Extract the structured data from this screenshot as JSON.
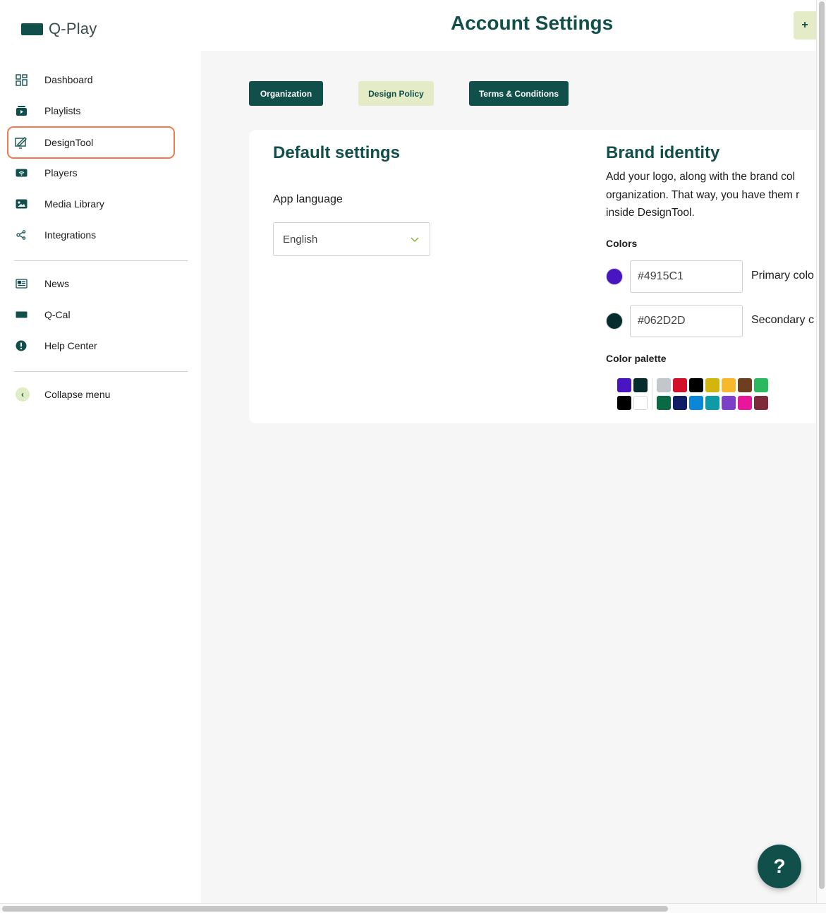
{
  "app": {
    "name": "Q-Play"
  },
  "sidebar": {
    "items": [
      {
        "label": "Dashboard",
        "icon": "dashboard-icon"
      },
      {
        "label": "Playlists",
        "icon": "playlists-icon"
      },
      {
        "label": "DesignTool",
        "icon": "designtool-icon",
        "active": true
      },
      {
        "label": "Players",
        "icon": "players-icon"
      },
      {
        "label": "Media Library",
        "icon": "media-library-icon"
      },
      {
        "label": "Integrations",
        "icon": "integrations-icon"
      }
    ],
    "secondary": [
      {
        "label": "News",
        "icon": "news-icon"
      },
      {
        "label": "Q-Cal",
        "icon": "q-cal-icon"
      },
      {
        "label": "Help Center",
        "icon": "help-center-icon"
      }
    ],
    "collapse_label": "Collapse menu"
  },
  "header": {
    "title": "Account Settings",
    "plus_label": "+"
  },
  "tabs": [
    {
      "label": "Organization",
      "style": "dark"
    },
    {
      "label": "Design Policy",
      "style": "light"
    },
    {
      "label": "Terms & Conditions",
      "style": "dark"
    }
  ],
  "default_settings": {
    "title": "Default settings",
    "language_label": "App language",
    "language_value": "English"
  },
  "brand_identity": {
    "title": "Brand identity",
    "description_lines": [
      "Add your logo, along with the brand col",
      "organization. That way, you have them r",
      "inside DesignTool."
    ],
    "colors_heading": "Colors",
    "primary": {
      "hex": "#4915C1",
      "label": "Primary colo"
    },
    "secondary": {
      "hex": "#062D2D",
      "label": "Secondary c"
    },
    "palette_heading": "Color palette",
    "palette_brand_top": [
      "#4915C1",
      "#062D2D"
    ],
    "palette_brand_bottom": [
      "#000000",
      "#FFFFFF"
    ],
    "palette_top": [
      "#C3C7CB",
      "#D3102A",
      "#000000",
      "#D4B40E",
      "#F6B92B",
      "#6B3F1F",
      "#2BB85E"
    ],
    "palette_bottom": [
      "#0A6A45",
      "#0E1F66",
      "#0A87D6",
      "#0E9AA6",
      "#7D3FC9",
      "#E8169B",
      "#7E2A3A"
    ]
  },
  "help": {
    "label": "?"
  },
  "colors": {
    "brand": "#114F4B",
    "accent_light": "#E3ECC6",
    "active_border": "#EF7A4F"
  }
}
